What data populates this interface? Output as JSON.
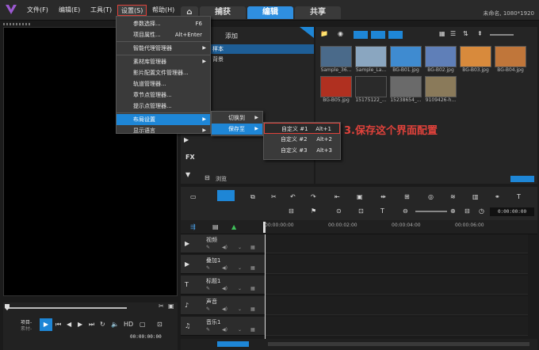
{
  "app": {
    "status": "未命名, 1080*1920"
  },
  "menubar": {
    "file": "文件(F)",
    "edit": "编辑(E)",
    "tools": "工具(T)",
    "settings": "设置(S)",
    "help": "帮助(H)"
  },
  "tabs": {
    "capture": "捕获",
    "edit": "编辑",
    "share": "共享"
  },
  "settings_menu": {
    "items": [
      {
        "label": "参数选择...",
        "shortcut": "F6"
      },
      {
        "label": "项目属性...",
        "shortcut": "Alt+Enter"
      },
      {
        "label": "智能代理管理器",
        "shortcut": ""
      },
      {
        "label": "素材库管理器",
        "shortcut": ""
      },
      {
        "label": "影片配置文件管理器...",
        "shortcut": ""
      },
      {
        "label": "轨道管理器...",
        "shortcut": ""
      },
      {
        "label": "章节点管理器...",
        "shortcut": ""
      },
      {
        "label": "提示点管理器...",
        "shortcut": ""
      },
      {
        "label": "布局设置",
        "shortcut": ""
      },
      {
        "label": "显示语言",
        "shortcut": ""
      }
    ]
  },
  "layout_submenu": {
    "switch_to": "切换到",
    "save_to": "保存至"
  },
  "save_submenu": [
    {
      "label": "自定义 #1",
      "shortcut": "Alt+1"
    },
    {
      "label": "自定义 #2",
      "shortcut": "Alt+2"
    },
    {
      "label": "自定义 #3",
      "shortcut": "Alt+3"
    }
  ],
  "annotation": "3.保存这个界面配置",
  "library": {
    "add": "添加",
    "folders": [
      "样本",
      "背景"
    ],
    "browse": "浏览",
    "thumbs": [
      {
        "label": "Sample_36...",
        "color": "#4a6a8a"
      },
      {
        "label": "Sample_La...",
        "color": "#8aa6c0"
      },
      {
        "label": "BG-B01.jpg",
        "color": "#3f8bd0"
      },
      {
        "label": "BG-B02.jpg",
        "color": "#5f7fb8"
      },
      {
        "label": "BG-B03.jpg",
        "color": "#d88a3c"
      },
      {
        "label": "BG-B04.jpg",
        "color": "#c0763a"
      },
      {
        "label": "BG-B05.jpg",
        "color": "#b03020"
      },
      {
        "label": "15175122_...",
        "color": "#2a2a2a"
      },
      {
        "label": "15238654_...",
        "color": "#6a6a6a"
      },
      {
        "label": "9109426-h...",
        "color": "#8a7a5a"
      }
    ]
  },
  "side_tools": {
    "fx": "FX"
  },
  "preview": {
    "project": "项目-",
    "clip": "素材-",
    "hd": "HD",
    "timecode": "00:00:00:00"
  },
  "timeline": {
    "timecode": "0:00:00:00",
    "ruler": [
      "00:00:00:00",
      "00:00:02:00",
      "00:00:04:00",
      "00:00:06:00"
    ],
    "tracks": [
      {
        "name": "视频",
        "icon": "▶"
      },
      {
        "name": "叠加1",
        "icon": "▶"
      },
      {
        "name": "标题1",
        "icon": "T"
      },
      {
        "name": "声音",
        "icon": "♪"
      },
      {
        "name": "音乐1",
        "icon": "♫"
      }
    ]
  },
  "colors": {
    "accent": "#1e86d6",
    "annotation": "#e0423b"
  }
}
